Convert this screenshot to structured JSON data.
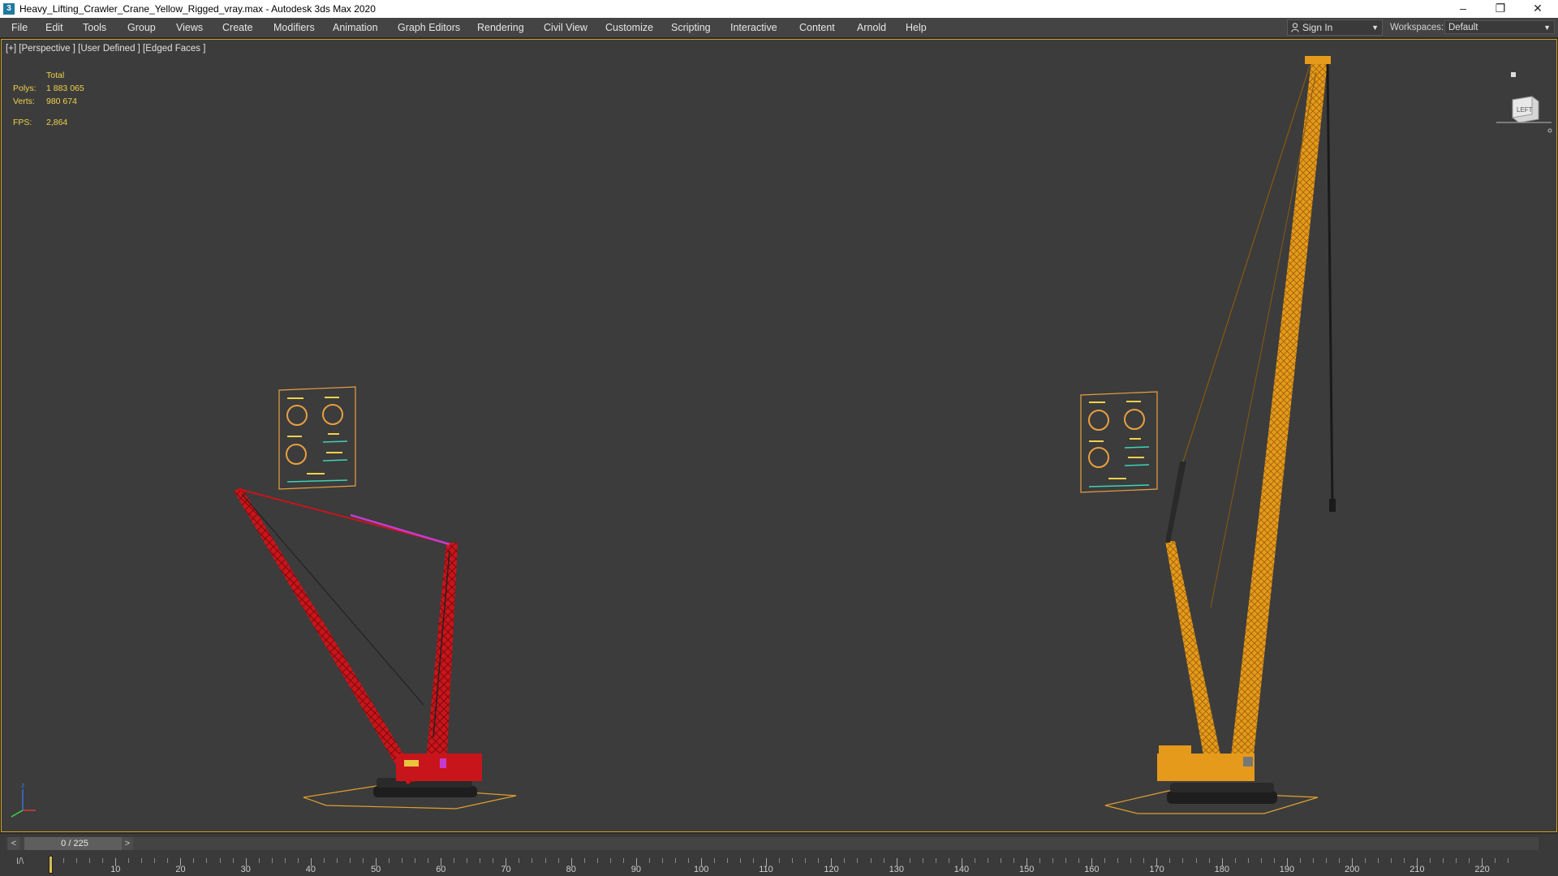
{
  "window": {
    "title": "Heavy_Lifting_Crawler_Crane_Yellow_Rigged_vray.max - Autodesk 3ds Max 2020",
    "app_icon": "3ds-max-icon",
    "controls": [
      "minimize-icon",
      "restore-icon",
      "close-icon"
    ]
  },
  "menu": {
    "items": [
      {
        "label": "File"
      },
      {
        "label": "Edit"
      },
      {
        "label": "Tools"
      },
      {
        "label": "Group"
      },
      {
        "label": "Views"
      },
      {
        "label": "Create"
      },
      {
        "label": "Modifiers"
      },
      {
        "label": "Animation"
      },
      {
        "label": "Graph Editors"
      },
      {
        "label": "Rendering"
      },
      {
        "label": "Civil View"
      },
      {
        "label": "Customize"
      },
      {
        "label": "Scripting"
      },
      {
        "label": "Interactive"
      },
      {
        "label": "Content"
      },
      {
        "label": "Arnold"
      },
      {
        "label": "Help"
      }
    ],
    "sign_in": "Sign In",
    "workspaces_label": "Workspaces:",
    "workspace_value": "Default"
  },
  "viewport": {
    "label": "[+] [Perspective ] [User Defined ] [Edged Faces ]",
    "stats": {
      "header": "Total",
      "polys_label": "Polys:",
      "polys": "1 883 065",
      "verts_label": "Verts:",
      "verts": "980 674",
      "fps_label": "FPS:",
      "fps": "2,864"
    },
    "viewcube_face": "LEFT",
    "colors": {
      "red_crane": "#c8151b",
      "yellow_crane": "#e59a1b",
      "ground_outline": "#e0a030",
      "panel_line": "#e8a040",
      "accent_cyan": "#3fd1b8",
      "magenta": "#c43bd0"
    }
  },
  "timeline": {
    "frame_display": "0 / 225",
    "prev": "<",
    "next": ">",
    "ruler_labels": [
      "10",
      "20",
      "30",
      "40",
      "50",
      "60",
      "70",
      "80",
      "90",
      "100",
      "110",
      "120",
      "130",
      "140",
      "150",
      "160",
      "170",
      "180",
      "190",
      "200",
      "210",
      "220"
    ]
  }
}
